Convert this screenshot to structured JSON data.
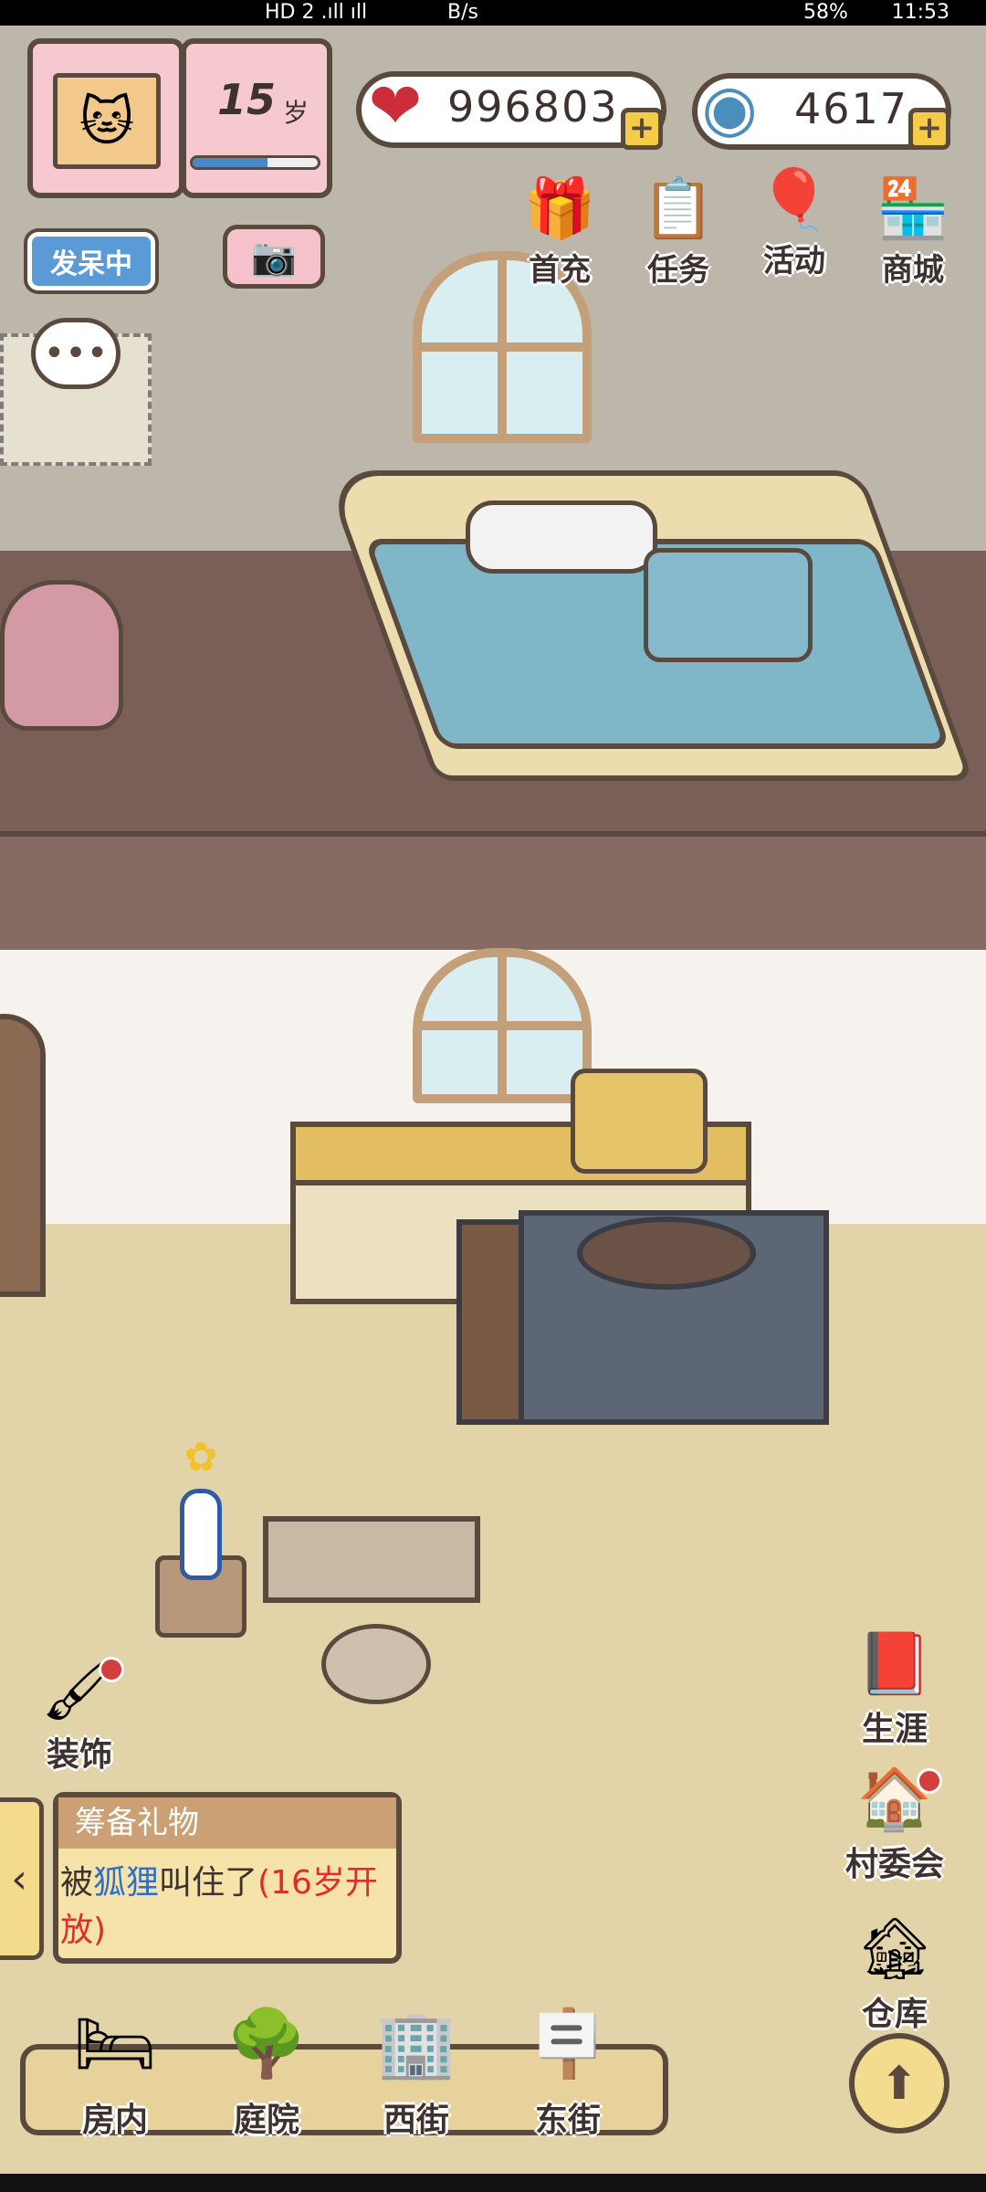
{
  "status_bar": {
    "left_text": "HD 2  .ıll ıll",
    "network_speed": "B/s",
    "battery": "58%",
    "time": "11:53"
  },
  "profile": {
    "age_number": "15",
    "age_unit": "岁",
    "age_progress": 0.6,
    "status_button": "发呆中"
  },
  "currency": {
    "hearts": "996803",
    "shells": "4617",
    "plus": "+"
  },
  "top_menu": [
    {
      "label": "首充",
      "icon": "gift-icon"
    },
    {
      "label": "任务",
      "icon": "clipboard-icon"
    },
    {
      "label": "活动",
      "icon": "balloon-icon"
    },
    {
      "label": "商城",
      "icon": "shop-icon"
    }
  ],
  "side_menu": [
    {
      "label": "生涯",
      "icon": "book-icon"
    },
    {
      "label": "村委会",
      "icon": "house-icon"
    },
    {
      "label": "仓库",
      "icon": "warehouse-icon"
    }
  ],
  "decorate": {
    "label": "装饰",
    "icon": "paint-icon"
  },
  "quest": {
    "title": "筹备礼物",
    "text_prefix": "被",
    "text_name": "狐狸",
    "text_mid": "叫住了",
    "text_note": "(16岁开放)"
  },
  "bottom_nav": [
    {
      "label": "房内",
      "icon": "bed-icon"
    },
    {
      "label": "庭院",
      "icon": "garden-icon"
    },
    {
      "label": "西街",
      "icon": "building-icon"
    },
    {
      "label": "东街",
      "icon": "signpost-icon"
    }
  ],
  "colors": {
    "wall": "#bdb6aa",
    "floor": "#7a5f58",
    "ground": "#e2d3a8",
    "accent_blue": "#5a9ad6",
    "heart_red": "#cc2d3a"
  }
}
